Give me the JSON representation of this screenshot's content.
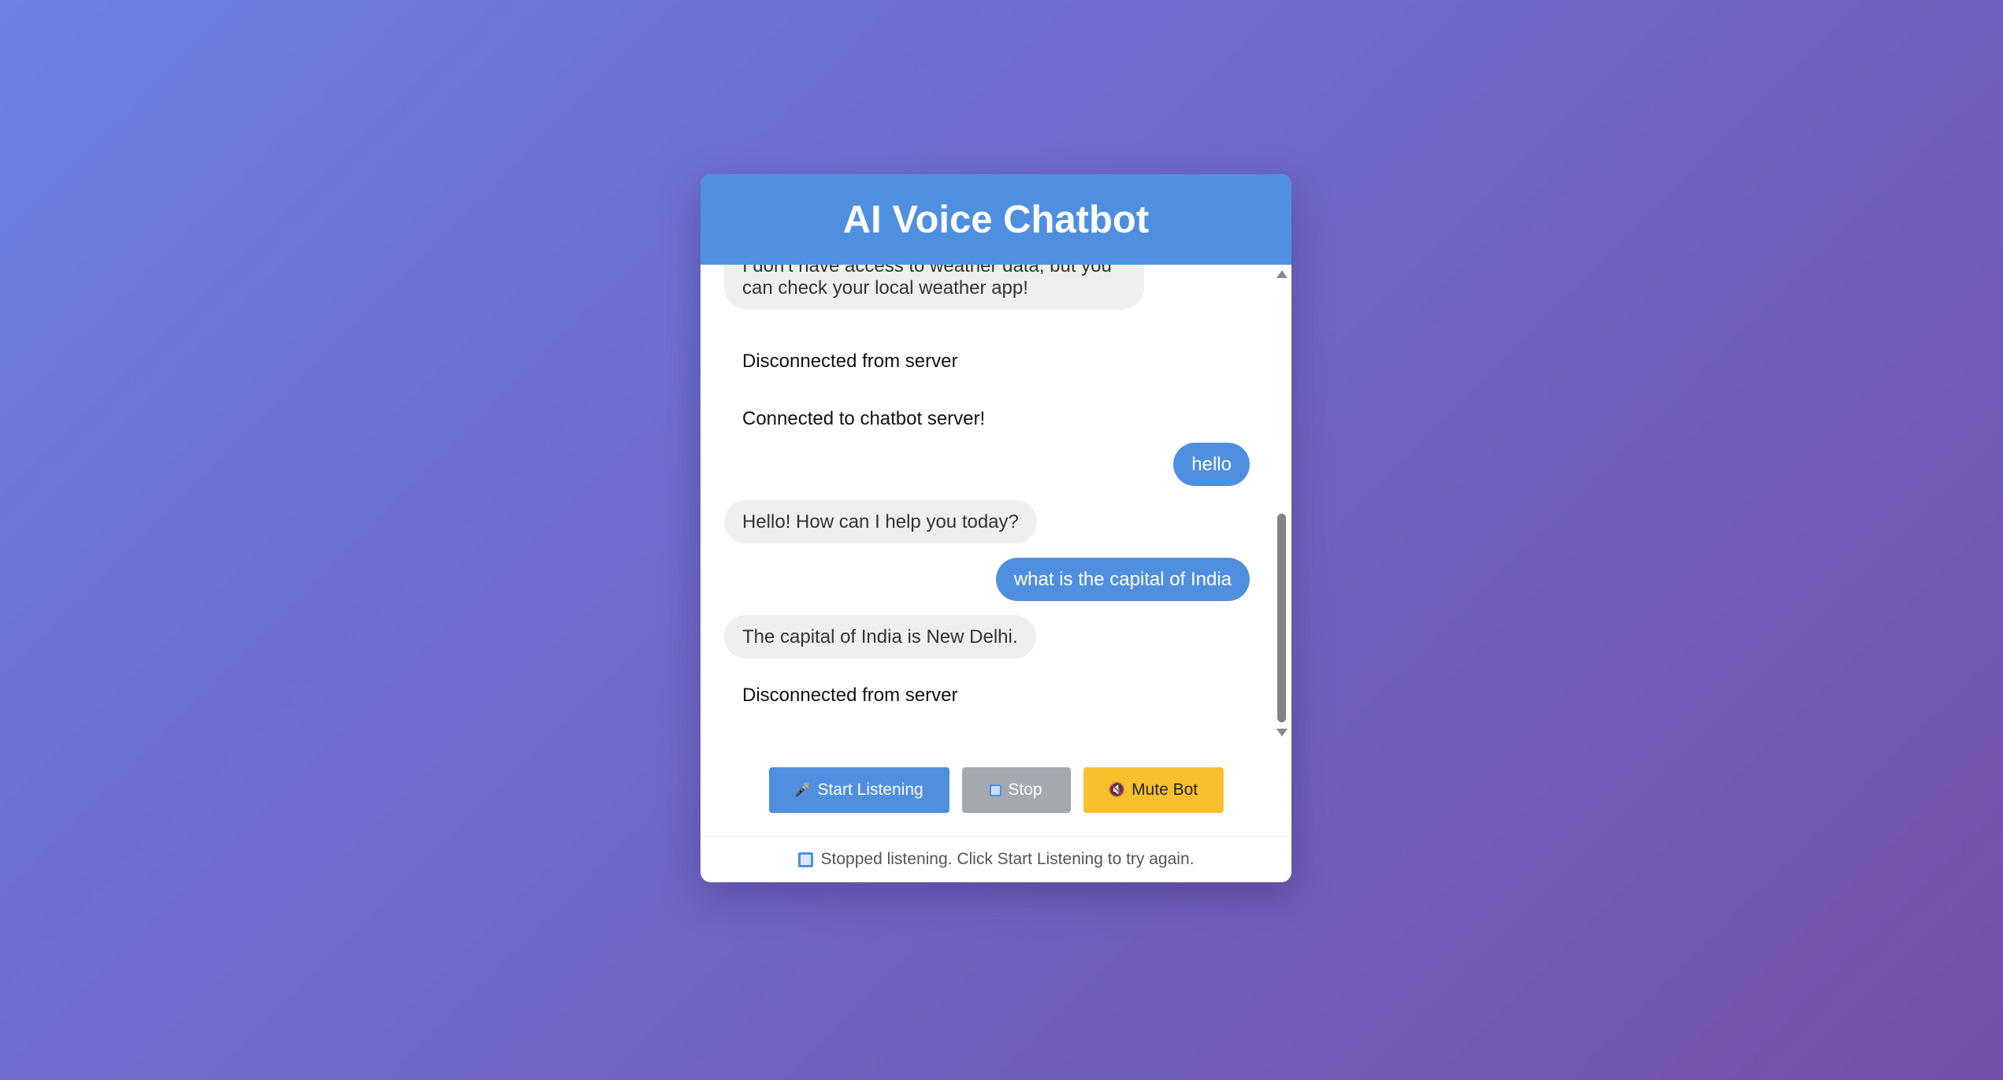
{
  "header": {
    "title": "AI Voice Chatbot"
  },
  "messages": [
    {
      "role": "bot",
      "text": "I don't have access to weather data, but you can check your local weather app!"
    },
    {
      "role": "system",
      "text": "Disconnected from server"
    },
    {
      "role": "system",
      "text": "Connected to chatbot server!"
    },
    {
      "role": "user",
      "text": "hello"
    },
    {
      "role": "bot",
      "text": "Hello! How can I help you today?"
    },
    {
      "role": "user",
      "text": "what is the capital of India"
    },
    {
      "role": "bot",
      "text": "The capital of India is New Delhi."
    },
    {
      "role": "system",
      "text": "Disconnected from server"
    }
  ],
  "controls": {
    "start": {
      "icon": "🎤",
      "icon_name": "microphone-icon",
      "label": "Start Listening"
    },
    "stop": {
      "icon_name": "stop-square-icon",
      "label": "Stop"
    },
    "mute": {
      "icon": "🔇",
      "icon_name": "muted-speaker-icon",
      "label": "Mute Bot"
    }
  },
  "status": {
    "icon_name": "stop-square-icon",
    "text": "Stopped listening. Click Start Listening to try again."
  },
  "colors": {
    "header_bg": "#4f8fe0",
    "user_bubble": "#4f8fe0",
    "bot_bubble": "#efefef",
    "start_button": "#4f8fe0",
    "stop_button": "#a4a9b0",
    "mute_button": "#f8c02c",
    "background_gradient_start": "#6c7fe4",
    "background_gradient_end": "#7450a8"
  }
}
